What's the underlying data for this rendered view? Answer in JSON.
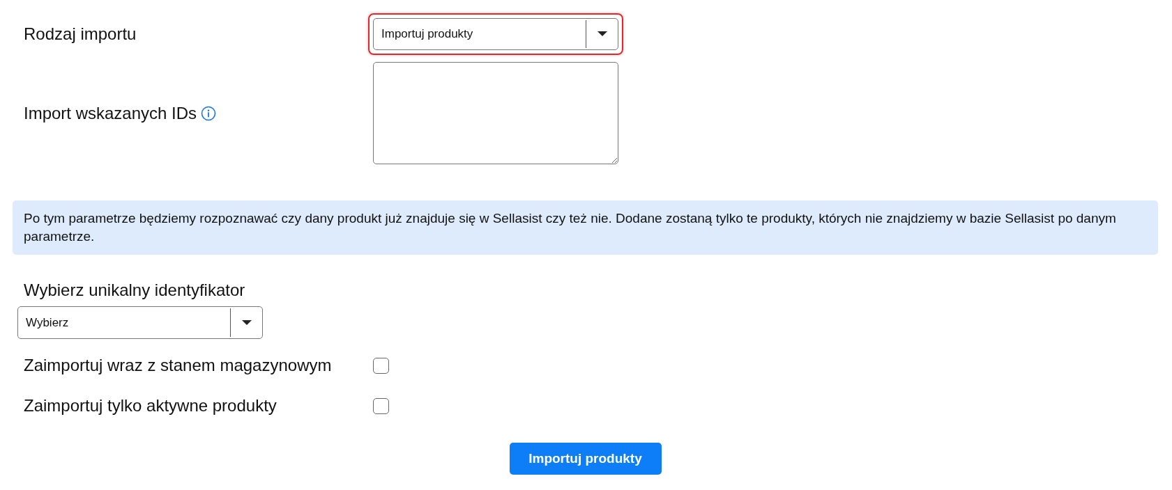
{
  "import_type": {
    "label": "Rodzaj importu",
    "value": "Importuj produkty",
    "highlighted": true
  },
  "ids": {
    "label": "Import wskazanych IDs"
  },
  "info": "Po tym parametrze będziemy rozpoznawać czy dany produkt już znajduje się w Sellasist czy też nie. Dodane zostaną tylko te produkty, których nie znajdziemy w bazie Sellasist po danym parametrze.",
  "identifier": {
    "label": "Wybierz unikalny identyfikator",
    "value": "Wybierz"
  },
  "options": [
    {
      "label": "Zaimportuj wraz z stanem magazynowym",
      "checked": false
    },
    {
      "label": "Zaimportuj tylko aktywne produkty",
      "checked": false
    }
  ],
  "submit": "Importuj produkty"
}
